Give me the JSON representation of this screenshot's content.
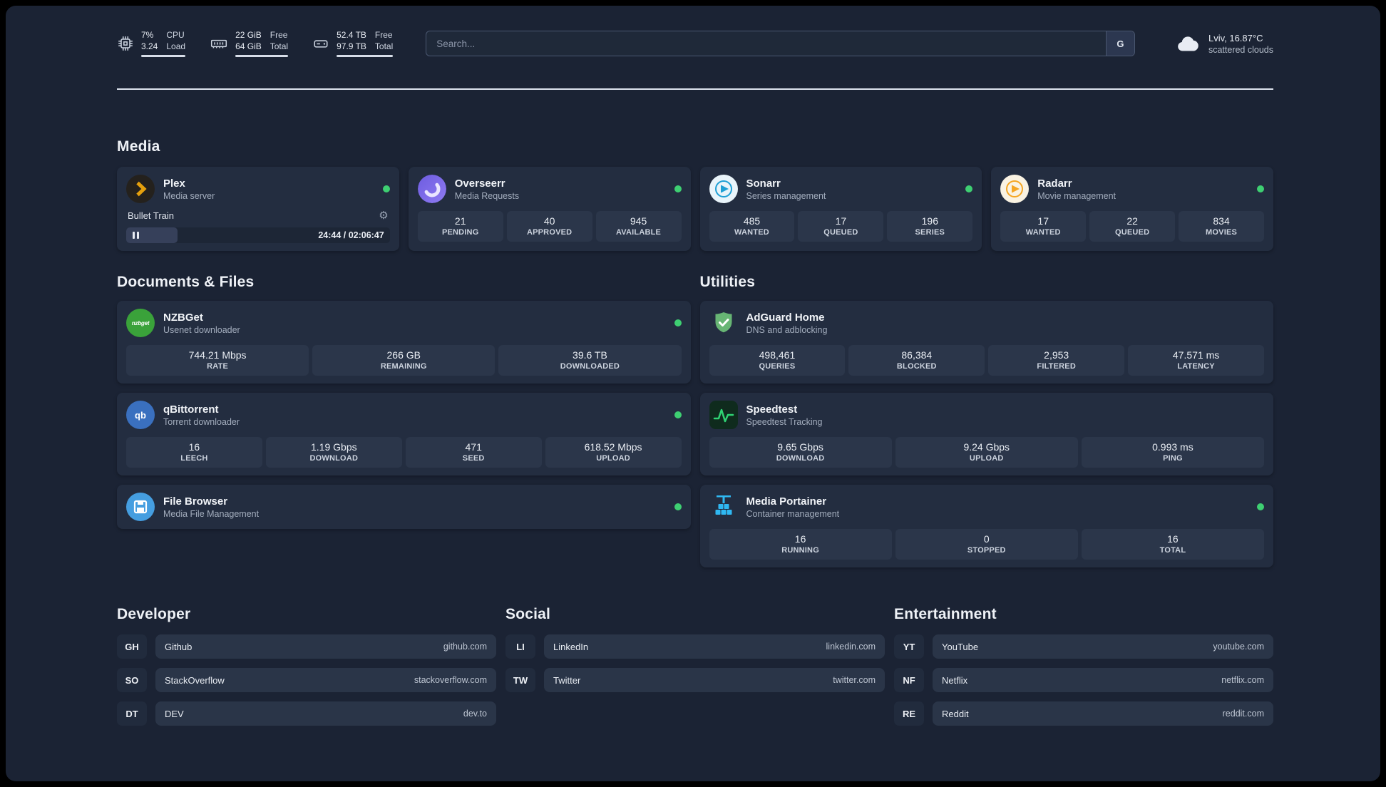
{
  "topbar": {
    "cpu": {
      "percent": "7%",
      "load": "3.24",
      "label1": "CPU",
      "label2": "Load"
    },
    "memory": {
      "free": "22 GiB",
      "total": "64 GiB",
      "label1": "Free",
      "label2": "Total"
    },
    "disk": {
      "free": "52.4 TB",
      "total": "97.9 TB",
      "label1": "Free",
      "label2": "Total"
    },
    "search": {
      "placeholder": "Search...",
      "engine": "G"
    },
    "weather": {
      "location": "Lviv, 16.87°C",
      "condition": "scattered clouds"
    }
  },
  "media": {
    "title": "Media",
    "plex": {
      "name": "Plex",
      "subtitle": "Media server",
      "player": {
        "title": "Bullet Train",
        "time": "24:44 / 02:06:47",
        "progress_percent": 19.5
      }
    },
    "overseerr": {
      "name": "Overseerr",
      "subtitle": "Media Requests",
      "stats": [
        {
          "value": "21",
          "label": "PENDING"
        },
        {
          "value": "40",
          "label": "APPROVED"
        },
        {
          "value": "945",
          "label": "AVAILABLE"
        }
      ]
    },
    "sonarr": {
      "name": "Sonarr",
      "subtitle": "Series management",
      "stats": [
        {
          "value": "485",
          "label": "WANTED"
        },
        {
          "value": "17",
          "label": "QUEUED"
        },
        {
          "value": "196",
          "label": "SERIES"
        }
      ]
    },
    "radarr": {
      "name": "Radarr",
      "subtitle": "Movie management",
      "stats": [
        {
          "value": "17",
          "label": "WANTED"
        },
        {
          "value": "22",
          "label": "QUEUED"
        },
        {
          "value": "834",
          "label": "MOVIES"
        }
      ]
    }
  },
  "documents": {
    "title": "Documents & Files",
    "nzbget": {
      "name": "NZBGet",
      "subtitle": "Usenet downloader",
      "icon_text": "nzbget",
      "stats": [
        {
          "value": "744.21 Mbps",
          "label": "RATE"
        },
        {
          "value": "266 GB",
          "label": "REMAINING"
        },
        {
          "value": "39.6 TB",
          "label": "DOWNLOADED"
        }
      ]
    },
    "qbittorrent": {
      "name": "qBittorrent",
      "subtitle": "Torrent downloader",
      "icon_text": "qb",
      "stats": [
        {
          "value": "16",
          "label": "LEECH"
        },
        {
          "value": "1.19 Gbps",
          "label": "DOWNLOAD"
        },
        {
          "value": "471",
          "label": "SEED"
        },
        {
          "value": "618.52 Mbps",
          "label": "UPLOAD"
        }
      ]
    },
    "filebrowser": {
      "name": "File Browser",
      "subtitle": "Media File Management"
    }
  },
  "utilities": {
    "title": "Utilities",
    "adguard": {
      "name": "AdGuard Home",
      "subtitle": "DNS and adblocking",
      "stats": [
        {
          "value": "498,461",
          "label": "QUERIES"
        },
        {
          "value": "86,384",
          "label": "BLOCKED"
        },
        {
          "value": "2,953",
          "label": "FILTERED"
        },
        {
          "value": "47.571 ms",
          "label": "LATENCY"
        }
      ]
    },
    "speedtest": {
      "name": "Speedtest",
      "subtitle": "Speedtest Tracking",
      "stats": [
        {
          "value": "9.65 Gbps",
          "label": "DOWNLOAD"
        },
        {
          "value": "9.24 Gbps",
          "label": "UPLOAD"
        },
        {
          "value": "0.993 ms",
          "label": "PING"
        }
      ]
    },
    "portainer": {
      "name": "Media Portainer",
      "subtitle": "Container management",
      "stats": [
        {
          "value": "16",
          "label": "RUNNING"
        },
        {
          "value": "0",
          "label": "STOPPED"
        },
        {
          "value": "16",
          "label": "TOTAL"
        }
      ]
    }
  },
  "bookmarks": {
    "developer": {
      "title": "Developer",
      "items": [
        {
          "abbr": "GH",
          "name": "Github",
          "url": "github.com"
        },
        {
          "abbr": "SO",
          "name": "StackOverflow",
          "url": "stackoverflow.com"
        },
        {
          "abbr": "DT",
          "name": "DEV",
          "url": "dev.to"
        }
      ]
    },
    "social": {
      "title": "Social",
      "items": [
        {
          "abbr": "LI",
          "name": "LinkedIn",
          "url": "linkedin.com"
        },
        {
          "abbr": "TW",
          "name": "Twitter",
          "url": "twitter.com"
        }
      ]
    },
    "entertainment": {
      "title": "Entertainment",
      "items": [
        {
          "abbr": "YT",
          "name": "YouTube",
          "url": "youtube.com"
        },
        {
          "abbr": "NF",
          "name": "Netflix",
          "url": "netflix.com"
        },
        {
          "abbr": "RE",
          "name": "Reddit",
          "url": "reddit.com"
        }
      ]
    }
  },
  "colors": {
    "status_online": "#3ecf72",
    "background": "#1b2334",
    "card": "#232d40",
    "stat_box": "#2b364a",
    "divider": "#dde3ed",
    "plex_accent": "#e5a00d",
    "sonarr_accent": "#1e9fd4",
    "radarr_accent": "#f5a623"
  }
}
